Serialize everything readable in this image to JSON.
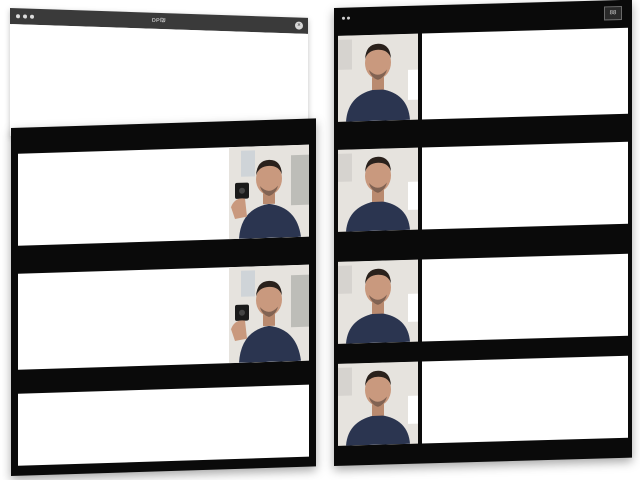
{
  "left_window": {
    "title": "ᴅᴘ₪",
    "close_icon": "close-icon"
  },
  "left_panel": {
    "rows": [
      {
        "has_video": true,
        "variant": "phone"
      },
      {
        "has_video": true,
        "variant": "phone"
      },
      {
        "has_video": false
      }
    ]
  },
  "right_panel": {
    "corner_label": "88",
    "rows": [
      {
        "has_video": true
      },
      {
        "has_video": true
      },
      {
        "has_video": true
      },
      {
        "has_video": true
      }
    ]
  },
  "colors": {
    "frame": "#0a0a0a",
    "content": "#ffffff",
    "shirt": "#2b3550",
    "skin": "#c9997e",
    "hair": "#2a211c"
  }
}
